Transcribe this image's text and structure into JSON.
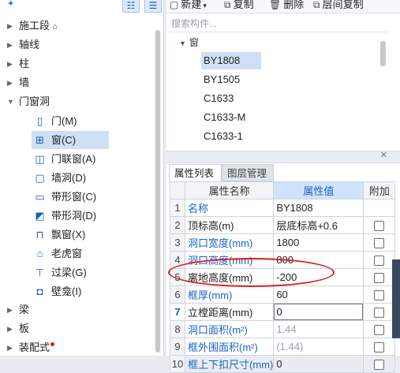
{
  "left_tree": {
    "top_icons": {
      "add": "✦",
      "view1": "☷",
      "view2": "☰"
    },
    "items": [
      {
        "label": "施工段",
        "expanded": false,
        "suffix_icon": "lock-icon"
      },
      {
        "label": "轴线",
        "expanded": false
      },
      {
        "label": "柱",
        "expanded": false
      },
      {
        "label": "墙",
        "expanded": false
      },
      {
        "label": "门窗洞",
        "expanded": true
      },
      {
        "label": "梁",
        "expanded": false
      },
      {
        "label": "板",
        "expanded": false
      },
      {
        "label": "装配式",
        "expanded": false,
        "badge": "red-dot"
      }
    ],
    "children": [
      {
        "label": "门(M)",
        "icon": "door-icon"
      },
      {
        "label": "窗(C)",
        "icon": "window-icon",
        "selected": true
      },
      {
        "label": "门联窗(A)",
        "icon": "door-window-icon"
      },
      {
        "label": "墙洞(D)",
        "icon": "wall-hole-icon"
      },
      {
        "label": "带形窗(C)",
        "icon": "strip-window-icon"
      },
      {
        "label": "带形洞(D)",
        "icon": "strip-hole-icon"
      },
      {
        "label": "飘窗(X)",
        "icon": "bay-window-icon"
      },
      {
        "label": "老虎窗",
        "icon": "dormer-icon"
      },
      {
        "label": "过梁(G)",
        "icon": "lintel-icon"
      },
      {
        "label": "壁龛(I)",
        "icon": "niche-icon"
      }
    ]
  },
  "toolbar": {
    "new_label": "新建",
    "new_arrow": "▾",
    "copy_label": "复制",
    "delete_label": "删除",
    "floor_copy_label": "层间复制"
  },
  "component_list": {
    "search_placeholder": "搜索构件...",
    "category": "窗",
    "items": [
      "BY1808",
      "BY1505",
      "C1633",
      "C1633-M",
      "C1633-1"
    ],
    "selected": "BY1808"
  },
  "tabs": {
    "properties": "属性列表",
    "layers": "图层管理"
  },
  "properties": {
    "headers": {
      "name": "属性名称",
      "value": "属性值",
      "extra": "附加"
    },
    "rows": [
      {
        "no": "1",
        "name": "名称",
        "value": "BY1808",
        "blue": true,
        "gray": false,
        "has_check": false
      },
      {
        "no": "2",
        "name": "顶标高(m)",
        "value": "层底标高+0.6",
        "blue": false,
        "gray": false,
        "has_check": true
      },
      {
        "no": "3",
        "name": "洞口宽度(mm)",
        "value": "1800",
        "blue": true,
        "gray": false,
        "has_check": true
      },
      {
        "no": "4",
        "name": "洞口高度(mm)",
        "value": "800",
        "blue": true,
        "gray": false,
        "has_check": true
      },
      {
        "no": "5",
        "name": "离地高度(mm)",
        "value": "-200",
        "blue": false,
        "gray": false,
        "has_check": true
      },
      {
        "no": "6",
        "name": "框厚(mm)",
        "value": "60",
        "blue": true,
        "gray": false,
        "has_check": true
      },
      {
        "no": "7",
        "name": "立樘距离(mm)",
        "value": "0",
        "blue": false,
        "gray": false,
        "has_check": true,
        "editing": true
      },
      {
        "no": "8",
        "name": "洞口面积(m²)",
        "value": "1.44",
        "blue": true,
        "gray": true,
        "has_check": true
      },
      {
        "no": "9",
        "name": "框外围面积(m²)",
        "value": "(1.44)",
        "blue": true,
        "gray": true,
        "has_check": true
      },
      {
        "no": "10",
        "name": "框上下扣尺寸(mm)",
        "value": "0",
        "blue": true,
        "gray": false,
        "has_check": true
      }
    ]
  },
  "colors": {
    "accent": "#1a64c8",
    "selection": "#cfe0f5",
    "highlight_ring": "#e01d1d"
  }
}
